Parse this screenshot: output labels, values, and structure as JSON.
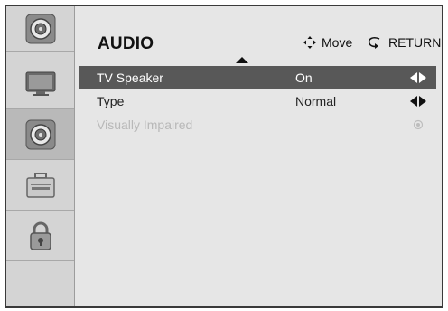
{
  "menu_title": "AUDIO",
  "hints": {
    "move_label": "Move",
    "return_label": "RETURN"
  },
  "sidebar": {
    "items": [
      {
        "name": "audio",
        "icon": "speaker-icon",
        "active": false
      },
      {
        "name": "picture",
        "icon": "tv-monitor-icon",
        "active": false
      },
      {
        "name": "audio",
        "icon": "speaker-icon",
        "active": true
      },
      {
        "name": "setup",
        "icon": "toolbox-icon",
        "active": false
      },
      {
        "name": "lock",
        "icon": "padlock-icon",
        "active": false
      }
    ]
  },
  "settings": [
    {
      "label": "TV Speaker",
      "value": "On",
      "selected": true,
      "enabled": true
    },
    {
      "label": "Type",
      "value": "Normal",
      "selected": false,
      "enabled": true
    },
    {
      "label": "Visually Impaired",
      "value": "",
      "selected": false,
      "enabled": false
    }
  ],
  "colors": {
    "frame_border": "#3a3a3a",
    "panel_bg": "#e6e6e6",
    "selected_row": "#585858"
  }
}
